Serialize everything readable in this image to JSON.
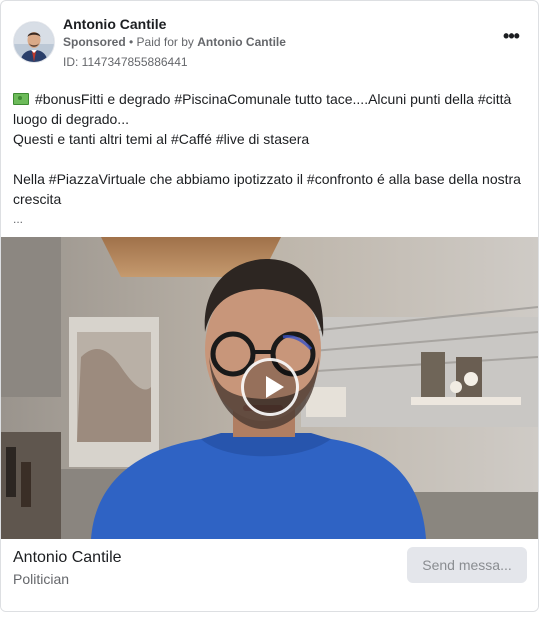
{
  "post": {
    "author": "Antonio Cantile",
    "sponsored": "Sponsored",
    "paid_for_prefix": " • Paid for by ",
    "paid_for_by": "Antonio Cantile",
    "ad_id": "ID: 1147347855886441",
    "more_icon": "…"
  },
  "body": {
    "line1": "#bonusFitti e degrado #PiscinaComunale tutto tace....Alcuni punti della #città luogo di degrado...",
    "line2": "Questi e tanti altri temi al #Caffé #live di stasera",
    "line3": "Nella #PiazzaVirtuale che abbiamo ipotizzato il #confronto é alla base della nostra crescita",
    "ellipsis": "..."
  },
  "footer": {
    "name": "Antonio Cantile",
    "category": "Politician",
    "cta_label": "Send messa..."
  },
  "icons": {
    "money": "money-bill-icon",
    "more": "more-dots-icon",
    "play": "play-icon"
  },
  "colors": {
    "cta_bg": "#e4e6eb",
    "cta_text": "#8a8d91",
    "shirt": "#2f63c4"
  }
}
